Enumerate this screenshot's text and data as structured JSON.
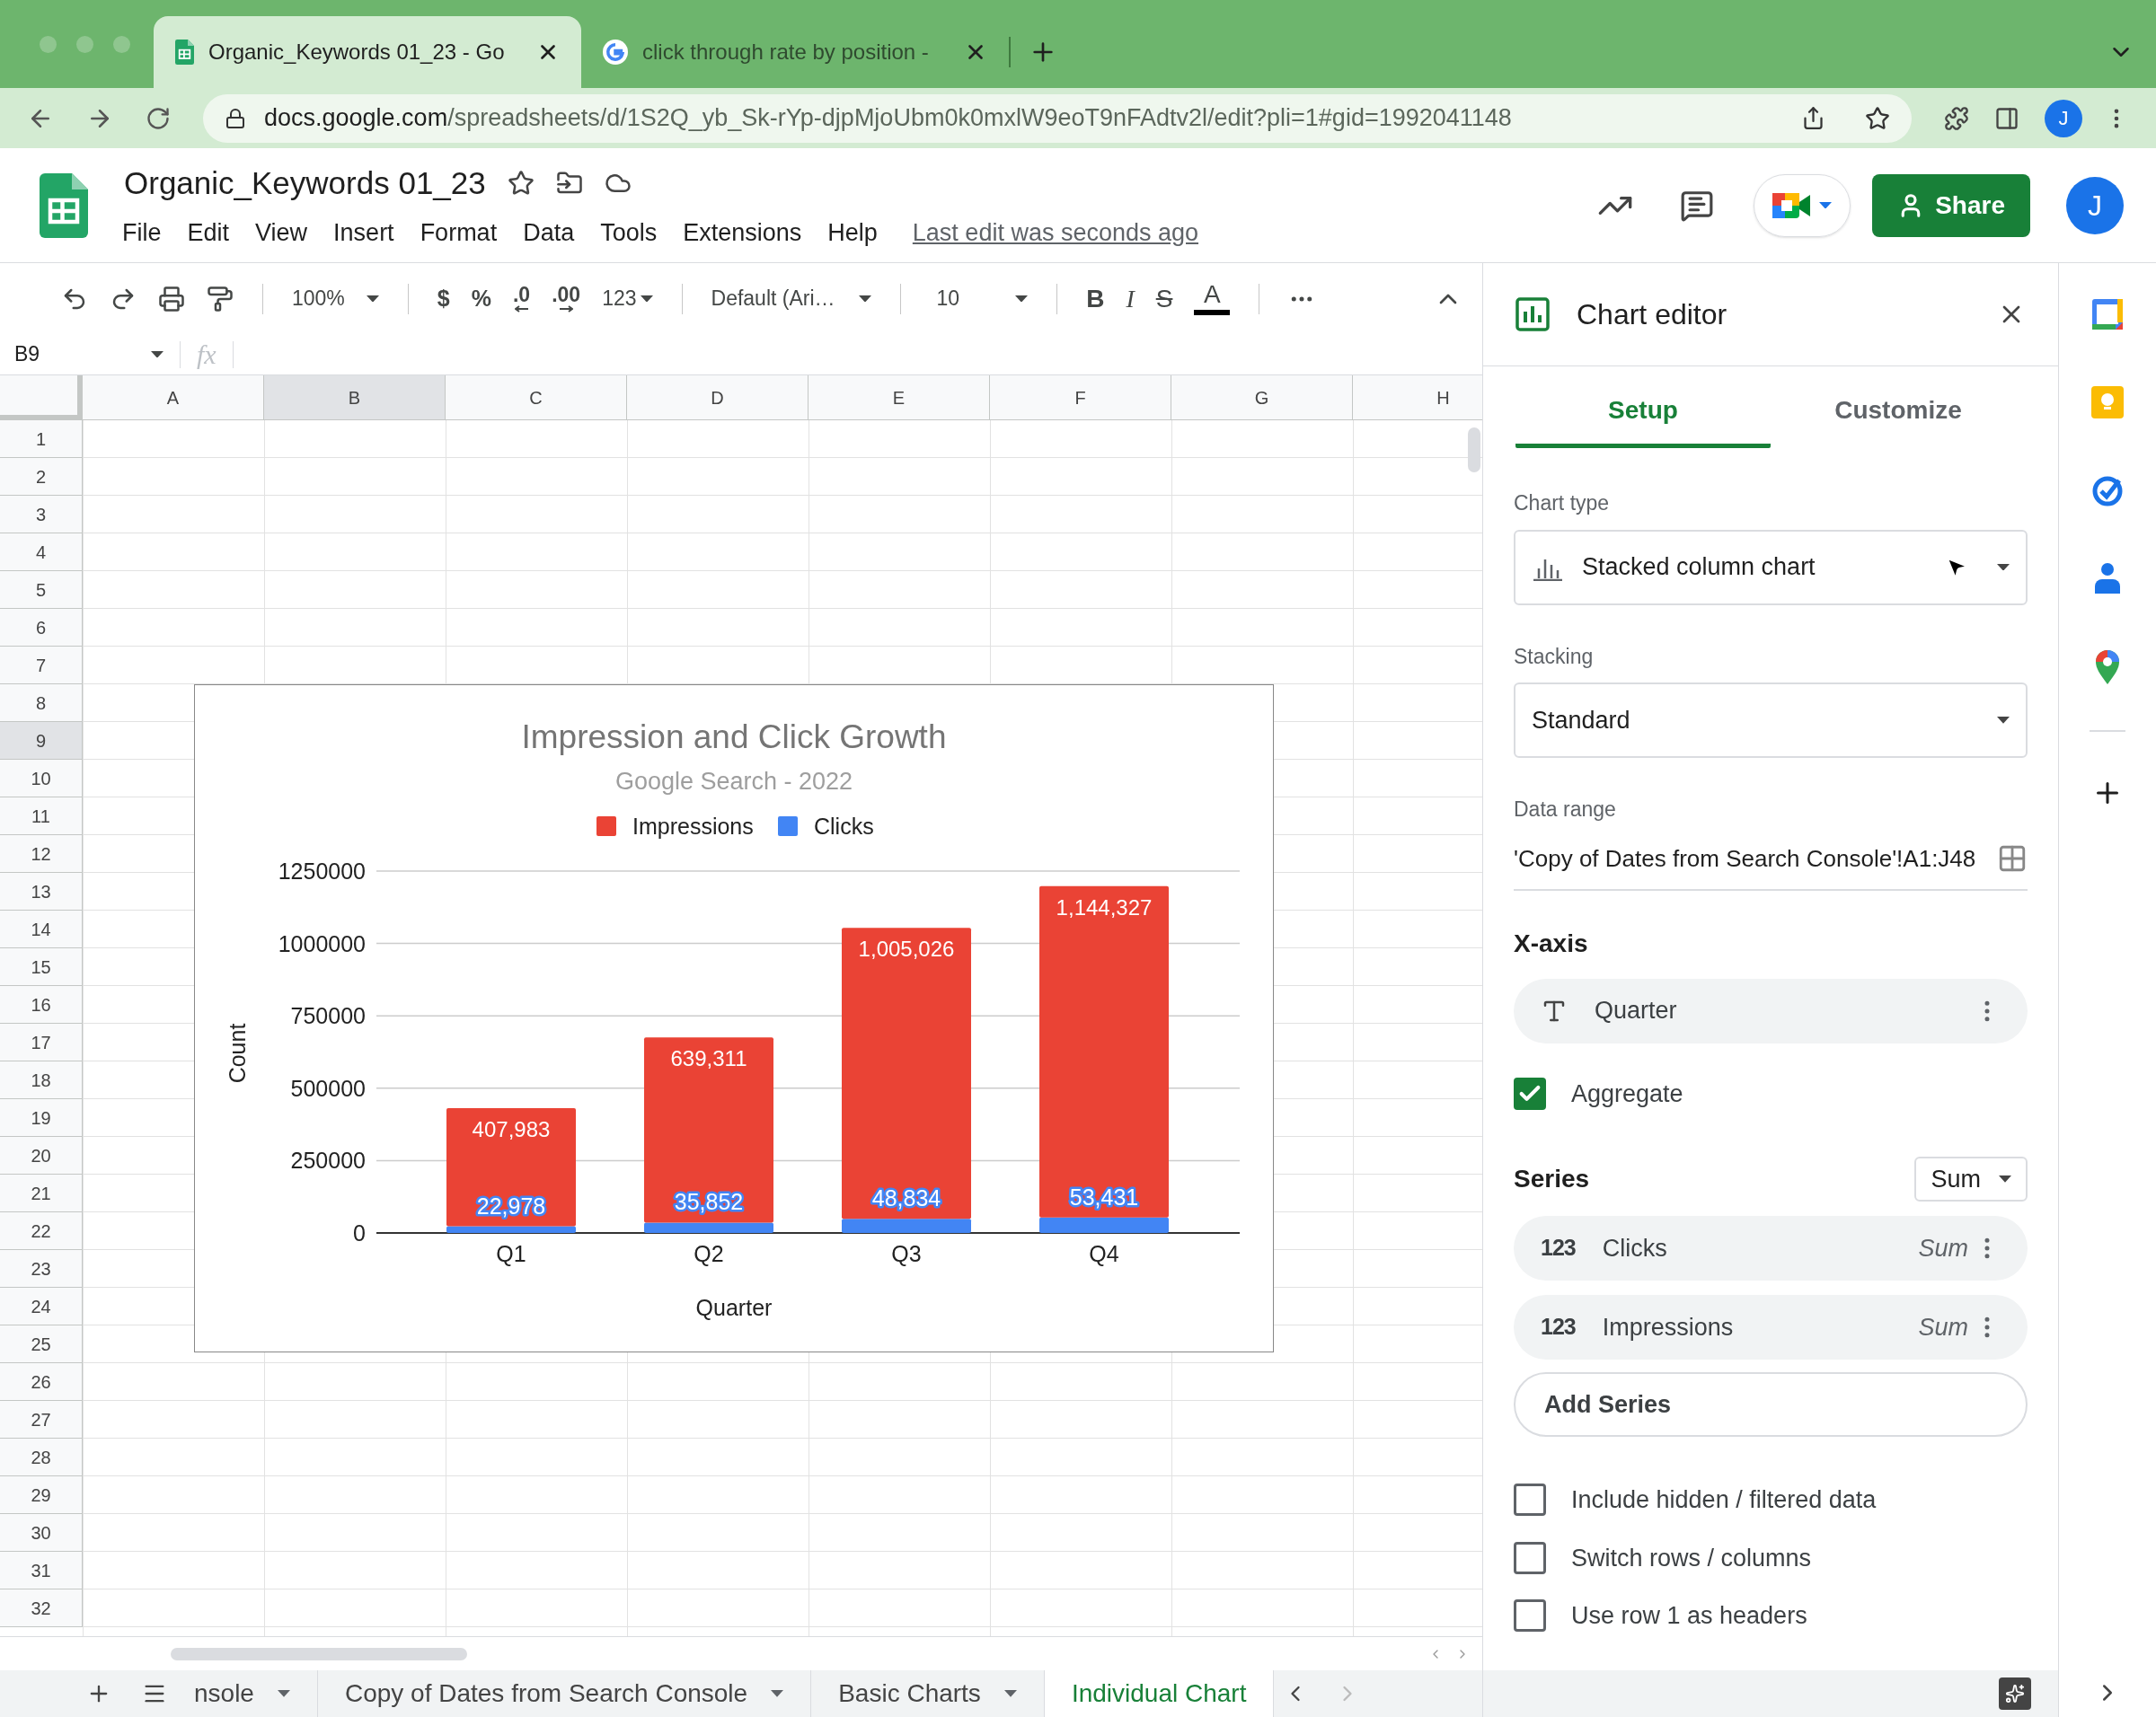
{
  "browser": {
    "tabs": [
      {
        "title": "Organic_Keywords 01_23 - Go",
        "selected": true,
        "kind": "sheets"
      },
      {
        "title": "click through rate by position -",
        "selected": false,
        "kind": "google"
      }
    ],
    "url_host": "docs.google.com",
    "url_path": "/spreadsheets/d/1S2Q_yb_Sk-rYp-djpMjoUbm0k0mxlW9eoT9nFAdtv2l/edit?pli=1#gid=1992041148",
    "avatar": "J"
  },
  "doc": {
    "title": "Organic_Keywords 01_23",
    "menus": [
      "File",
      "Edit",
      "View",
      "Insert",
      "Format",
      "Data",
      "Tools",
      "Extensions",
      "Help"
    ],
    "last_edit": "Last edit was seconds ago",
    "share": "Share",
    "avatar": "J"
  },
  "toolbar": {
    "zoom": "100%",
    "currency": "$",
    "percent": "%",
    "decrease_decimal": ".0",
    "increase_decimal": ".00",
    "number_format": "123",
    "font": "Default (Ari…",
    "font_size": "10",
    "bold": "B",
    "italic": "I",
    "strike": "S",
    "text_color": "A"
  },
  "formula_bar": {
    "cell": "B9",
    "function_label": "fx"
  },
  "grid": {
    "columns": [
      {
        "label": "A",
        "selected": false
      },
      {
        "label": "B",
        "selected": true
      },
      {
        "label": "C",
        "selected": false
      },
      {
        "label": "D",
        "selected": false
      },
      {
        "label": "E",
        "selected": false
      },
      {
        "label": "F",
        "selected": false
      },
      {
        "label": "G",
        "selected": false
      },
      {
        "label": "H",
        "selected": false
      }
    ],
    "rows": [
      {
        "label": "1",
        "selected": false
      },
      {
        "label": "2",
        "selected": false
      },
      {
        "label": "3",
        "selected": false
      },
      {
        "label": "4",
        "selected": false
      },
      {
        "label": "5",
        "selected": false
      },
      {
        "label": "6",
        "selected": false
      },
      {
        "label": "7",
        "selected": false
      },
      {
        "label": "8",
        "selected": false
      },
      {
        "label": "9",
        "selected": true
      },
      {
        "label": "10",
        "selected": false
      },
      {
        "label": "11",
        "selected": false
      },
      {
        "label": "12",
        "selected": false
      },
      {
        "label": "13",
        "selected": false
      },
      {
        "label": "14",
        "selected": false
      },
      {
        "label": "15",
        "selected": false
      },
      {
        "label": "16",
        "selected": false
      },
      {
        "label": "17",
        "selected": false
      },
      {
        "label": "18",
        "selected": false
      },
      {
        "label": "19",
        "selected": false
      },
      {
        "label": "20",
        "selected": false
      },
      {
        "label": "21",
        "selected": false
      },
      {
        "label": "22",
        "selected": false
      },
      {
        "label": "23",
        "selected": false
      },
      {
        "label": "24",
        "selected": false
      },
      {
        "label": "25",
        "selected": false
      },
      {
        "label": "26",
        "selected": false
      },
      {
        "label": "27",
        "selected": false
      },
      {
        "label": "28",
        "selected": false
      },
      {
        "label": "29",
        "selected": false
      },
      {
        "label": "30",
        "selected": false
      },
      {
        "label": "31",
        "selected": false
      },
      {
        "label": "32",
        "selected": false
      }
    ]
  },
  "chart": {
    "subtitle": "Google Search - 2022",
    "chart_data": {
      "type": "bar",
      "title": "Impression and Click Growth",
      "xlabel": "Quarter",
      "ylabel": "Count",
      "categories": [
        "Q1",
        "Q2",
        "Q3",
        "Q4"
      ],
      "series": [
        {
          "name": "Impressions",
          "color": "#ea4335",
          "values": [
            407983,
            639311,
            1005026,
            1144327
          ],
          "value_labels": [
            "407,983",
            "639,311",
            "1,005,026",
            "1,144,327"
          ]
        },
        {
          "name": "Clicks",
          "color": "#4285f4",
          "values": [
            22978,
            35852,
            48834,
            53431
          ],
          "value_labels": [
            "22,978",
            "35,852",
            "48,834",
            "53,431"
          ]
        }
      ],
      "ylim": [
        0,
        1250000
      ],
      "yticks": [
        0,
        250000,
        500000,
        750000,
        1000000,
        1250000
      ],
      "stacked": true,
      "orientation": "vertical",
      "grid": true,
      "legend": "top"
    }
  },
  "editor": {
    "title": "Chart editor",
    "tabs": [
      {
        "label": "Setup",
        "selected": true
      },
      {
        "label": "Customize",
        "selected": false
      }
    ],
    "chart_type": {
      "label": "Chart type",
      "value": "Stacked column chart"
    },
    "stacking": {
      "label": "Stacking",
      "value": "Standard"
    },
    "data_range": {
      "label": "Data range",
      "value": "'Copy of Dates from Search Console'!A1:J48"
    },
    "x_axis": {
      "heading": "X-axis",
      "chip": "Quarter"
    },
    "aggregate": {
      "label": "Aggregate",
      "checked": true
    },
    "series": {
      "heading": "Series",
      "aggregate": "Sum",
      "items": [
        {
          "type_label": "123",
          "label": "Clicks",
          "fn": "Sum"
        },
        {
          "type_label": "123",
          "label": "Impressions",
          "fn": "Sum"
        }
      ]
    },
    "add_series": "Add Series",
    "options": [
      {
        "label": "Include hidden / filtered data",
        "checked": false
      },
      {
        "label": "Switch rows / columns",
        "checked": false
      },
      {
        "label": "Use row 1 as headers",
        "checked": false
      }
    ]
  },
  "sheet_tabs": [
    {
      "label": "nsole",
      "selected": false
    },
    {
      "label": "Copy of Dates from Search Console",
      "selected": false
    },
    {
      "label": "Basic Charts",
      "selected": false
    },
    {
      "label": "Individual Chart",
      "selected": true
    }
  ]
}
